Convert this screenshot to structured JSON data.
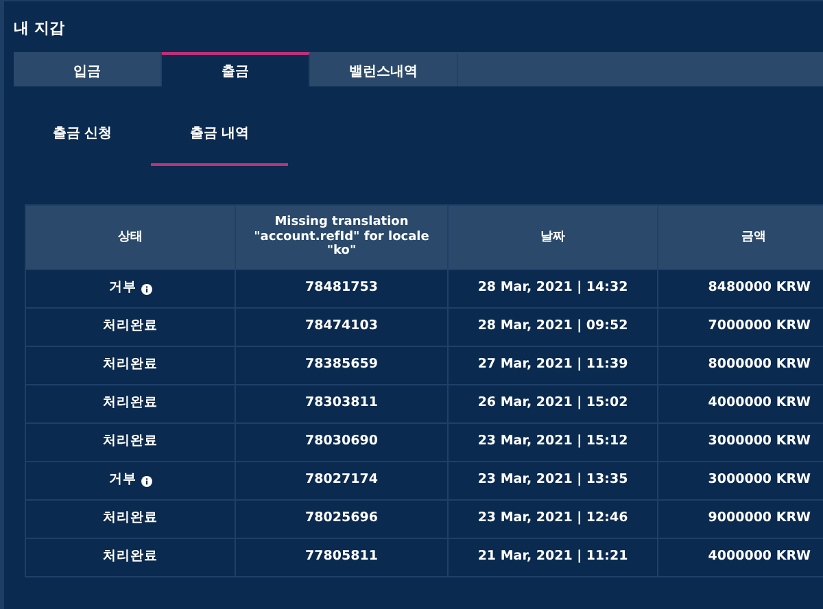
{
  "title": "내 지갑",
  "tabs": [
    {
      "label": "입금",
      "selected": false
    },
    {
      "label": "출금",
      "selected": true
    },
    {
      "label": "밸런스내역",
      "selected": false
    }
  ],
  "subtabs": [
    {
      "label": "출금 신청",
      "selected": false
    },
    {
      "label": "출금 내역",
      "selected": true
    }
  ],
  "table": {
    "columns": [
      "상태",
      "Missing translation \"account.refId\" for locale \"ko\"",
      "날짜",
      "금액"
    ],
    "rows": [
      {
        "status": "거부",
        "info": true,
        "ref": "78481753",
        "date": "28 Mar, 2021 | 14:32",
        "amount": "8480000 KRW"
      },
      {
        "status": "처리완료",
        "info": false,
        "ref": "78474103",
        "date": "28 Mar, 2021 | 09:52",
        "amount": "7000000 KRW"
      },
      {
        "status": "처리완료",
        "info": false,
        "ref": "78385659",
        "date": "27 Mar, 2021 | 11:39",
        "amount": "8000000 KRW"
      },
      {
        "status": "처리완료",
        "info": false,
        "ref": "78303811",
        "date": "26 Mar, 2021 | 15:02",
        "amount": "4000000 KRW"
      },
      {
        "status": "처리완료",
        "info": false,
        "ref": "78030690",
        "date": "23 Mar, 2021 | 15:12",
        "amount": "3000000 KRW"
      },
      {
        "status": "거부",
        "info": true,
        "ref": "78027174",
        "date": "23 Mar, 2021 | 13:35",
        "amount": "3000000 KRW"
      },
      {
        "status": "처리완료",
        "info": false,
        "ref": "78025696",
        "date": "23 Mar, 2021 | 12:46",
        "amount": "9000000 KRW"
      },
      {
        "status": "처리완료",
        "info": false,
        "ref": "77805811",
        "date": "21 Mar, 2021 | 11:21",
        "amount": "4000000 KRW"
      }
    ]
  }
}
